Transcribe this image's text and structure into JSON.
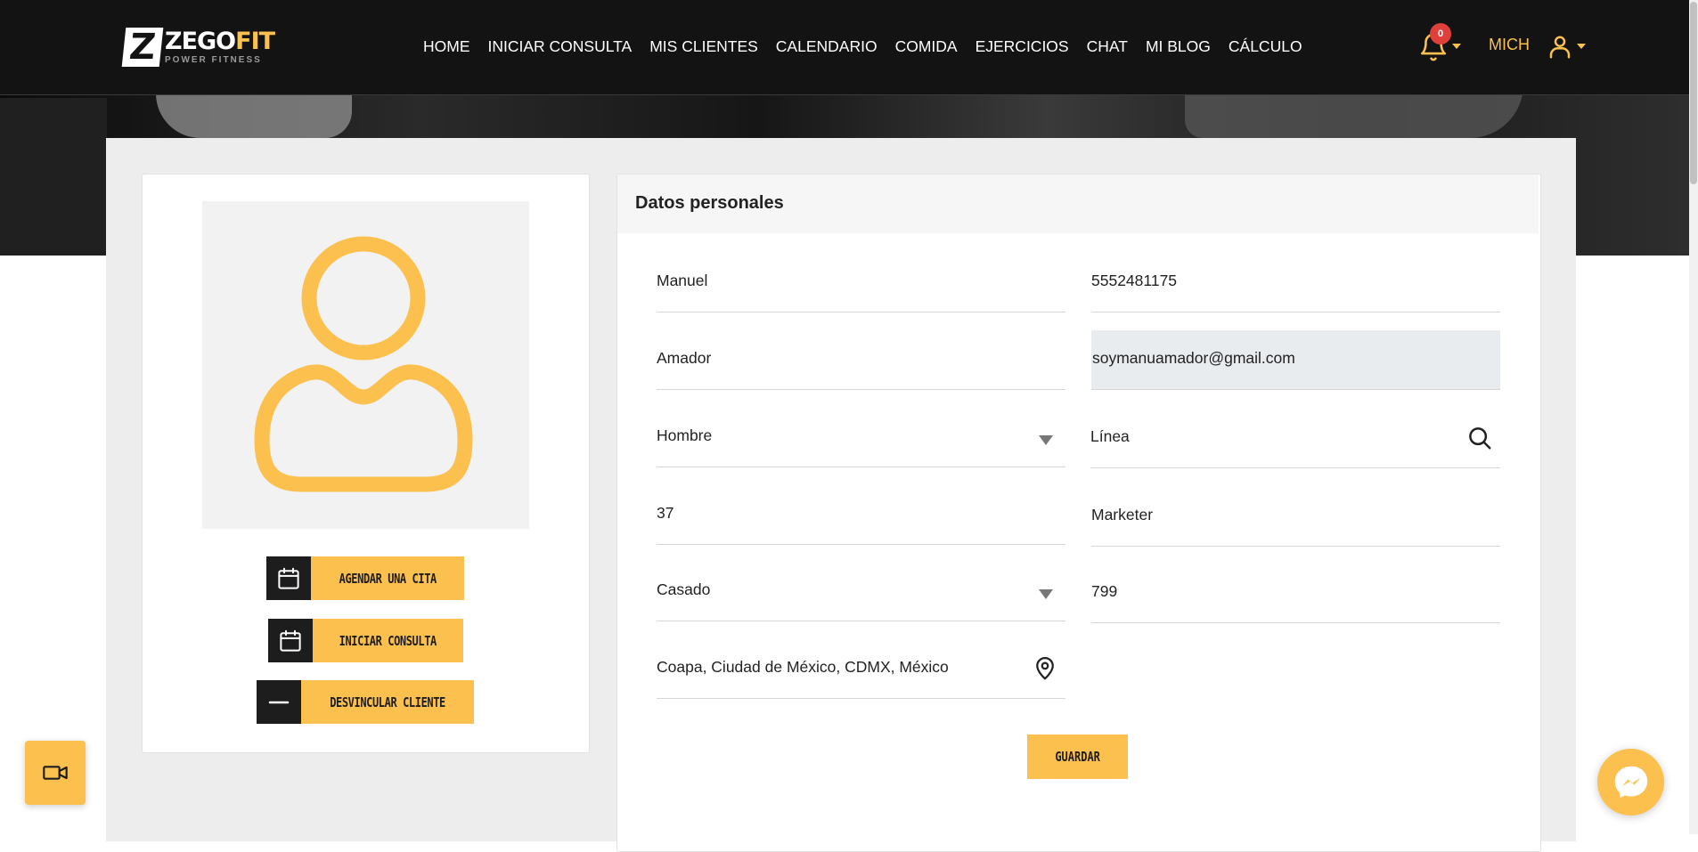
{
  "brand": {
    "logo_letter": "Z",
    "word1": "ZEGO",
    "word2": "FIT",
    "tagline": "POWER FITNESS",
    "accent_color": "#fbc04e",
    "dark_color": "#131313"
  },
  "nav": {
    "items": [
      "HOME",
      "INICIAR CONSULTA",
      "MIS CLIENTES",
      "CALENDARIO",
      "COMIDA",
      "EJERCICIOS",
      "CHAT",
      "MI BLOG",
      "CÁLCULO"
    ]
  },
  "header": {
    "notification_count": "0",
    "user_name": "MICH"
  },
  "profile": {
    "avatar_icon": "user-outline-icon",
    "actions": [
      {
        "label": "AGENDAR UNA CITA",
        "icon": "calendar-icon"
      },
      {
        "label": "INICIAR CONSULTA",
        "icon": "calendar-icon"
      },
      {
        "label": "DESVINCULAR CLIENTE",
        "icon": "minus-icon"
      }
    ]
  },
  "personal_data": {
    "title": "Datos personales",
    "first_name": "Manuel",
    "phone": "5552481175",
    "last_name": "Amador",
    "email": "soymanuamador@gmail.com",
    "gender": "Hombre",
    "line": "Línea",
    "age": "37",
    "occupation": "Marketer",
    "marital_status": "Casado",
    "code": "799",
    "location": "Coapa, Ciudad de México, CDMX, México",
    "save_label": "GUARDAR"
  }
}
